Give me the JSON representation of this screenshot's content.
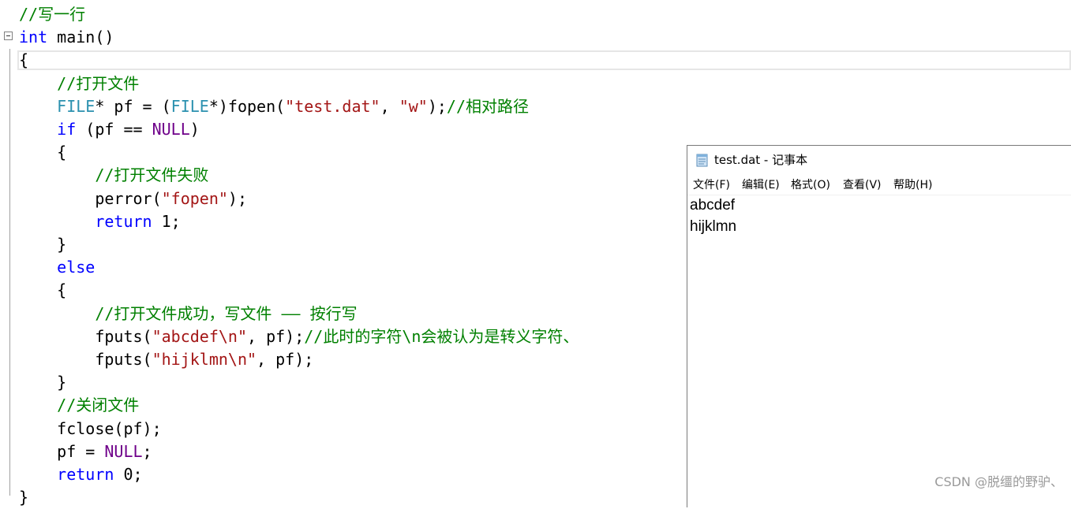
{
  "editor": {
    "lines": [
      [
        {
          "t": "//写一行",
          "c": "comment"
        }
      ],
      [
        {
          "t": "int",
          "c": "kw"
        },
        {
          "t": " main()",
          "c": "plain"
        }
      ],
      [
        {
          "t": "{",
          "c": "plain"
        }
      ],
      [
        {
          "t": "    ",
          "c": "plain"
        },
        {
          "t": "//打开文件",
          "c": "comment"
        }
      ],
      [
        {
          "t": "    ",
          "c": "plain"
        },
        {
          "t": "FILE",
          "c": "type"
        },
        {
          "t": "* pf = (",
          "c": "plain"
        },
        {
          "t": "FILE",
          "c": "type"
        },
        {
          "t": "*)fopen(",
          "c": "plain"
        },
        {
          "t": "\"test.dat\"",
          "c": "str"
        },
        {
          "t": ", ",
          "c": "plain"
        },
        {
          "t": "\"w\"",
          "c": "str"
        },
        {
          "t": ");",
          "c": "plain"
        },
        {
          "t": "//相对路径",
          "c": "comment"
        }
      ],
      [
        {
          "t": "    ",
          "c": "plain"
        },
        {
          "t": "if",
          "c": "kw"
        },
        {
          "t": " (pf == ",
          "c": "plain"
        },
        {
          "t": "NULL",
          "c": "macro"
        },
        {
          "t": ")",
          "c": "plain"
        }
      ],
      [
        {
          "t": "    {",
          "c": "plain"
        }
      ],
      [
        {
          "t": "        ",
          "c": "plain"
        },
        {
          "t": "//打开文件失败",
          "c": "comment"
        }
      ],
      [
        {
          "t": "        perror(",
          "c": "plain"
        },
        {
          "t": "\"fopen\"",
          "c": "str"
        },
        {
          "t": ");",
          "c": "plain"
        }
      ],
      [
        {
          "t": "        ",
          "c": "plain"
        },
        {
          "t": "return",
          "c": "kw"
        },
        {
          "t": " 1;",
          "c": "plain"
        }
      ],
      [
        {
          "t": "    }",
          "c": "plain"
        }
      ],
      [
        {
          "t": "    ",
          "c": "plain"
        },
        {
          "t": "else",
          "c": "kw"
        }
      ],
      [
        {
          "t": "    {",
          "c": "plain"
        }
      ],
      [
        {
          "t": "        ",
          "c": "plain"
        },
        {
          "t": "//打开文件成功，写文件 —— 按行写",
          "c": "comment"
        }
      ],
      [
        {
          "t": "        fputs(",
          "c": "plain"
        },
        {
          "t": "\"abcdef\\n\"",
          "c": "str"
        },
        {
          "t": ", pf);",
          "c": "plain"
        },
        {
          "t": "//此时的字符\\n会被认为是转义字符、",
          "c": "comment"
        }
      ],
      [
        {
          "t": "        fputs(",
          "c": "plain"
        },
        {
          "t": "\"hijklmn\\n\"",
          "c": "str"
        },
        {
          "t": ", pf);",
          "c": "plain"
        }
      ],
      [
        {
          "t": "    }",
          "c": "plain"
        }
      ],
      [
        {
          "t": "    ",
          "c": "plain"
        },
        {
          "t": "//关闭文件",
          "c": "comment"
        }
      ],
      [
        {
          "t": "    fclose(pf);",
          "c": "plain"
        }
      ],
      [
        {
          "t": "    pf = ",
          "c": "plain"
        },
        {
          "t": "NULL",
          "c": "macro"
        },
        {
          "t": ";",
          "c": "plain"
        }
      ],
      [
        {
          "t": "    ",
          "c": "plain"
        },
        {
          "t": "return",
          "c": "kw"
        },
        {
          "t": " 0;",
          "c": "plain"
        }
      ],
      [
        {
          "t": "}",
          "c": "plain"
        }
      ]
    ]
  },
  "notepad": {
    "title": "test.dat - 记事本",
    "icon": "notepad-icon",
    "menu": [
      "文件(F)",
      "编辑(E)",
      "格式(O)",
      "查看(V)",
      "帮助(H)"
    ],
    "content": [
      "abcdef",
      "hijklmn"
    ]
  },
  "watermark": "CSDN @脱缰的野驴、",
  "colors": {
    "comment": "#008000",
    "keyword": "#0000ff",
    "type": "#2b91af",
    "string": "#a31515",
    "macro": "#6f008a"
  }
}
